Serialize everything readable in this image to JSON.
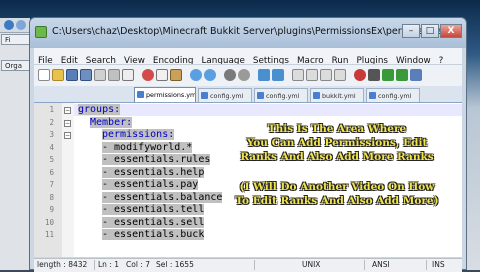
{
  "window": {
    "title": "C:\\Users\\chaz\\Desktop\\Minecraft Bukkit Server\\plugins\\PermissionsEx\\permissions.y...",
    "minimize": "–",
    "maximize": "□",
    "close": "X"
  },
  "desktop": {
    "left_items": [
      "Fi",
      "Orga",
      "",
      ""
    ]
  },
  "menu": [
    "File",
    "Edit",
    "Search",
    "View",
    "Encoding",
    "Language",
    "Settings",
    "Macro",
    "Run",
    "Plugins",
    "Window",
    "?"
  ],
  "tabs": [
    {
      "label": "permissions.yml",
      "active": true
    },
    {
      "label": "config.yml",
      "active": false
    },
    {
      "label": "config.yml",
      "active": false
    },
    {
      "label": "bukkit.yml",
      "active": false
    },
    {
      "label": "config.yml",
      "active": false
    }
  ],
  "editor": {
    "lines": [
      {
        "n": "1",
        "text": "groups:",
        "indent": 0
      },
      {
        "n": "2",
        "text": "Member:",
        "indent": 1
      },
      {
        "n": "3",
        "text": "permissions:",
        "indent": 2
      },
      {
        "n": "4",
        "text": "- modifyworld.*",
        "indent": 2
      },
      {
        "n": "5",
        "text": "- essentials.rules",
        "indent": 2
      },
      {
        "n": "6",
        "text": "- essentials.help",
        "indent": 2
      },
      {
        "n": "7",
        "text": "- essentials.pay",
        "indent": 2
      },
      {
        "n": "8",
        "text": "- essentials.balance",
        "indent": 2
      },
      {
        "n": "9",
        "text": "- essentials.tell",
        "indent": 2
      },
      {
        "n": "10",
        "text": "- essentials.sell",
        "indent": 2
      },
      {
        "n": "11",
        "text": "- essentials.buck",
        "indent": 2
      }
    ]
  },
  "annotation": {
    "line1": "This Is The Area Where",
    "line2": "You Can Add Permissions, Edit",
    "line3": "Ranks And Also Add More Ranks",
    "line4": "(I Will Do Another Video On How",
    "line5": "To Edit Ranks And Also Add More)"
  },
  "status": {
    "length": "length : 8432",
    "ln": "Ln : 1",
    "col": "Col : 7",
    "sel": "Sel : 1655",
    "eol": "UNIX",
    "encoding": "ANSI",
    "mode": "INS"
  }
}
